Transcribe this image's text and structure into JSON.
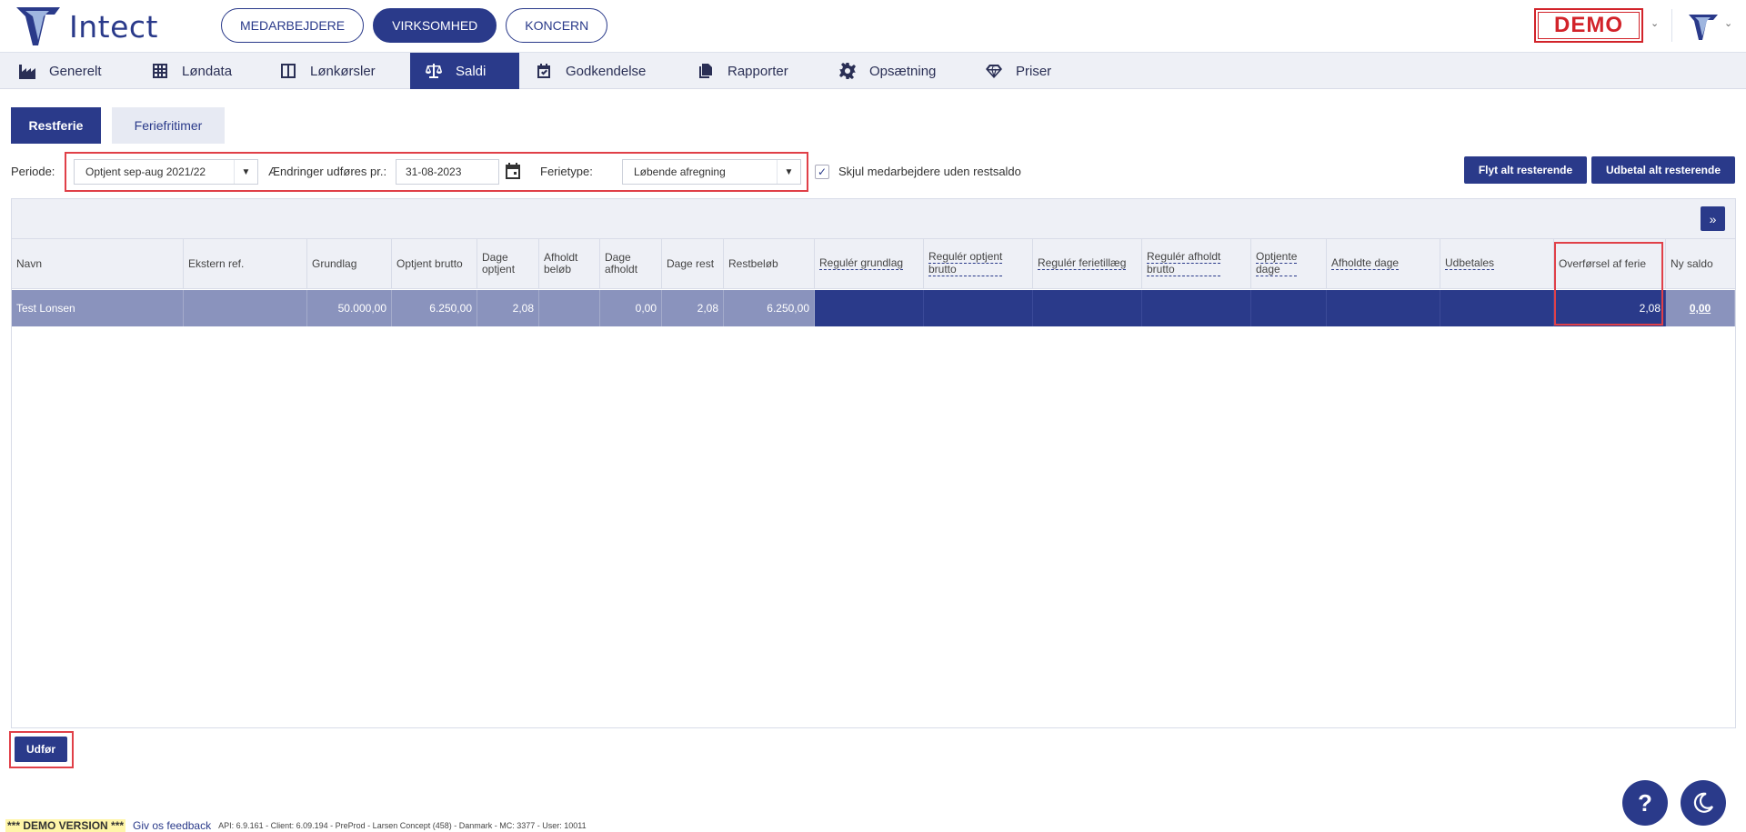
{
  "app": {
    "name": "Intect"
  },
  "topnav": [
    {
      "label": "MEDARBEJDERE",
      "active": false
    },
    {
      "label": "VIRKSOMHED",
      "active": true
    },
    {
      "label": "KONCERN",
      "active": false
    }
  ],
  "demo_badge": "DEMO",
  "tabs": [
    {
      "label": "Generelt",
      "icon": "factory-icon"
    },
    {
      "label": "Løndata",
      "icon": "table-grid-icon"
    },
    {
      "label": "Lønkørsler",
      "icon": "columns-icon"
    },
    {
      "label": "Saldi",
      "icon": "scale-icon",
      "active": true
    },
    {
      "label": "Godkendelse",
      "icon": "calendar-check-icon"
    },
    {
      "label": "Rapporter",
      "icon": "documents-icon"
    },
    {
      "label": "Opsætning",
      "icon": "gear-icon"
    },
    {
      "label": "Priser",
      "icon": "diamond-icon"
    }
  ],
  "subtabs": {
    "active": "Restferie",
    "inactive": "Feriefritimer"
  },
  "filters": {
    "periode_label": "Periode:",
    "periode_value": "Optjent sep-aug 2021/22",
    "changes_label": "Ændringer udføres pr.:",
    "changes_date": "31-08-2023",
    "ferietype_label": "Ferietype:",
    "ferietype_value": "Løbende afregning",
    "hide_label": "Skjul medarbejdere uden restsaldo",
    "hide_checked": true
  },
  "actions": {
    "move_all": "Flyt alt resterende",
    "pay_all": "Udbetal alt resterende",
    "execute": "Udfør",
    "expand": "»"
  },
  "table": {
    "headers": {
      "navn": "Navn",
      "ekstern": "Ekstern ref.",
      "grundlag": "Grundlag",
      "optjent_brutto": "Optjent brutto",
      "dage_optjent_1": "Dage",
      "dage_optjent_2": "optjent",
      "afholdt_belob_1": "Afholdt",
      "afholdt_belob_2": "beløb",
      "dage_afholdt_1": "Dage",
      "dage_afholdt_2": "afholdt",
      "dage_rest": "Dage rest",
      "restbelob": "Restbeløb",
      "reg_grundlag": "Regulér grundlag",
      "reg_optjent_1": "Regulér optjent",
      "reg_optjent_2": "brutto",
      "reg_ferietillaeg": "Regulér ferietillæg",
      "reg_afholdt_1": "Regulér afholdt",
      "reg_afholdt_2": "brutto",
      "optjente_dage_1": "Optjente",
      "optjente_dage_2": "dage",
      "afholdte_dage": "Afholdte dage",
      "udbetales": "Udbetales",
      "overforsel": "Overførsel af ferie",
      "ny_saldo": "Ny saldo"
    },
    "row": {
      "navn": "Test Lonsen",
      "ekstern": "",
      "grundlag": "50.000,00",
      "optjent_brutto": "6.250,00",
      "dage_optjent": "2,08",
      "afholdt_belob": "",
      "dage_afholdt": "0,00",
      "dage_rest": "2,08",
      "restbelob": "6.250,00",
      "overforsel": "2,08",
      "ny_saldo": "0,00"
    }
  },
  "fabs": {
    "help": "?",
    "theme": "moon-icon"
  },
  "footer": {
    "demo": "*** DEMO VERSION ***",
    "feedback": "Giv os feedback",
    "meta": "API: 6.9.161 - Client: 6.09.194 - PreProd - Larsen Concept (458) - Danmark - MC: 3377 - User: 10011"
  }
}
